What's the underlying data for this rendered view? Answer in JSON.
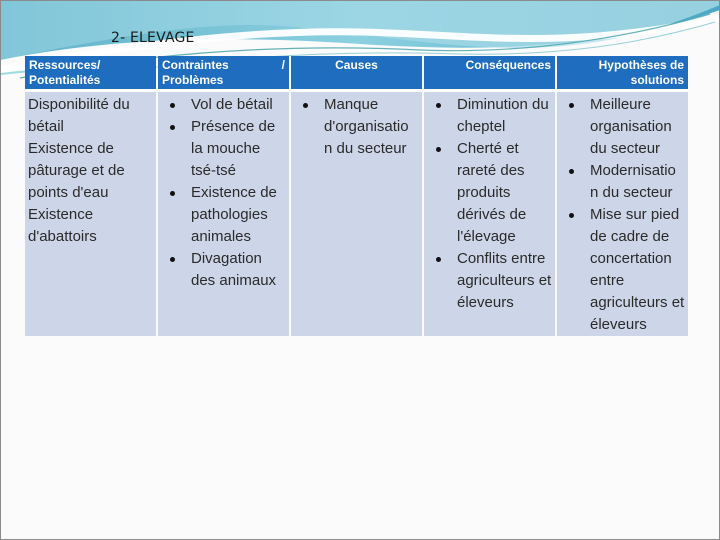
{
  "slide": {
    "title": "2- ELEVAGE"
  },
  "colors": {
    "header_bg": "#1f6dbf",
    "cell_bg": "#cdd6e8",
    "banner_teal": "#7ec3d6"
  },
  "table": {
    "headers": {
      "col1": "Ressources/ Potentialités",
      "col2_a": "Contraintes",
      "col2_b": "/",
      "col2_c": "Problèmes",
      "col3": "Causes",
      "col4": "Conséquences",
      "col5": "Hypothèses de solutions"
    },
    "row": {
      "ressources": [
        "Disponibilité du bétail",
        "Existence de pâturage et de points d'eau",
        "Existence d'abattoirs"
      ],
      "contraintes": [
        "Vol de bétail",
        "Présence de la mouche tsé-tsé",
        "Existence de pathologies animales",
        "Divagation des animaux"
      ],
      "causes": [
        "Manque d'organisatio n du secteur"
      ],
      "consequences": [
        "Diminution du cheptel",
        "Cherté et rareté des produits dérivés de l'élevage",
        "Conflits entre agriculteurs et éleveurs"
      ],
      "solutions": [
        "Meilleure organisation du secteur",
        "Modernisatio n du secteur",
        "Mise sur pied de cadre de concertation entre agriculteurs et éleveurs"
      ]
    }
  }
}
